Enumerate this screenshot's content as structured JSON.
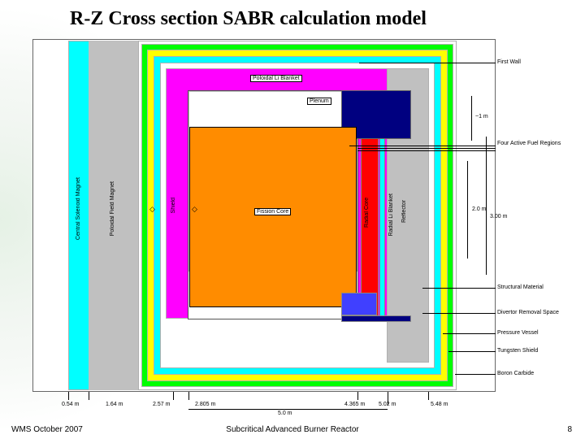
{
  "title": "R-Z Cross section SABR calculation model",
  "footer": {
    "left": "WMS October 2007",
    "center": "Subcritical Advanced Burner Reactor",
    "right": "8"
  },
  "labels": {
    "central_solenoid": "Central Solenoid Magnet",
    "poloidal": "Poloidal Field Magnet",
    "shield": "Shield",
    "poloidal_li": "Poloidal Li Blanket",
    "plenum": "Plenum",
    "fission_core": "Fission Core",
    "radial_core": "Radial Core",
    "radial_li": "Radial Li Blanket",
    "reflector": "Reflector"
  },
  "right_labels": {
    "first_wall": "First Wall",
    "four_fuel": "Four Active Fuel Regions",
    "structural": "Structural Material",
    "divertor": "Divertor Removal Space",
    "pressure": "Pressure Vessel",
    "tungsten": "Tungsten Shield",
    "boron": "Boron Carbide"
  },
  "dims": {
    "d1": "0.54 m",
    "d2": "1.64 m",
    "d3": "2.57 m",
    "d4": "2.805 m",
    "d5": "4.365 m",
    "d6": "5.02 m",
    "d7": "5.48 m",
    "bottom": "5.0 m",
    "h1": "~1 m",
    "h2": "2.0 m",
    "h3": "3.00 m"
  }
}
